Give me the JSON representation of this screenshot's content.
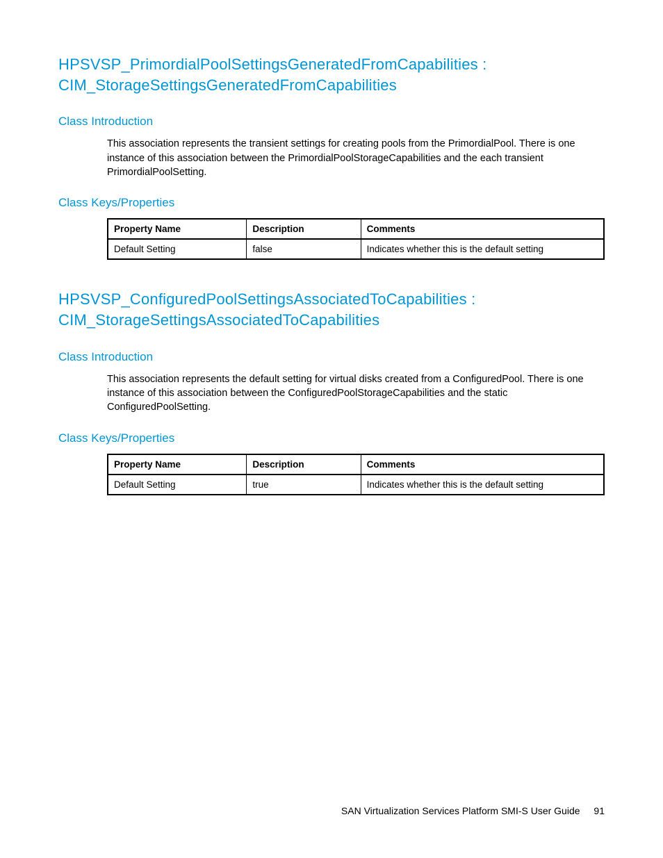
{
  "sections": [
    {
      "heading": "HPSVSP_PrimordialPoolSettingsGeneratedFromCapabilities : CIM_StorageSettingsGeneratedFromCapabilities",
      "intro_label": "Class Introduction",
      "intro_text": "This association represents the transient settings for creating pools from the PrimordialPool. There is one instance of this association between the PrimordialPoolStorageCapabilities and the each transient PrimordialPoolSetting.",
      "props_label": "Class Keys/Properties",
      "table": {
        "headers": [
          "Property Name",
          "Description",
          "Comments"
        ],
        "rows": [
          [
            "Default Setting",
            "false",
            "Indicates whether this is the default setting"
          ]
        ]
      }
    },
    {
      "heading": "HPSVSP_ConfiguredPoolSettingsAssociatedToCapabilities : CIM_StorageSettingsAssociatedToCapabilities",
      "intro_label": "Class Introduction",
      "intro_text": "This association represents the default setting for virtual disks created from a ConfiguredPool. There is one instance of this association between the ConfiguredPoolStorageCapabilities and the static ConfiguredPoolSetting.",
      "props_label": "Class Keys/Properties",
      "table": {
        "headers": [
          "Property Name",
          "Description",
          "Comments"
        ],
        "rows": [
          [
            "Default Setting",
            "true",
            "Indicates whether this is the default setting"
          ]
        ]
      }
    }
  ],
  "footer": {
    "title": "SAN Virtualization Services Platform SMI-S User Guide",
    "page": "91"
  }
}
